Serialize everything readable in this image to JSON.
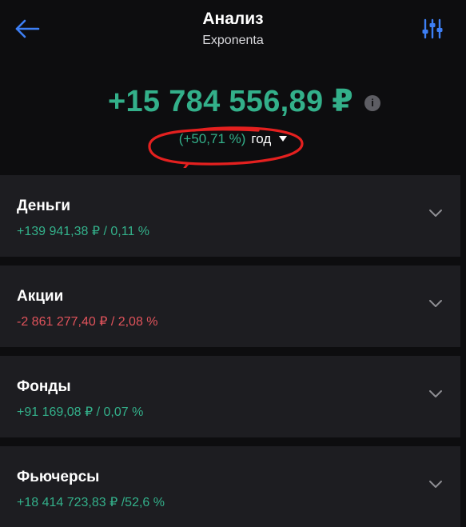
{
  "header": {
    "title": "Анализ",
    "subtitle": "Exponenta",
    "back_icon": "back-arrow-icon",
    "filter_icon": "sliders-icon"
  },
  "summary": {
    "total": "+15 784 556,89 ₽",
    "info_icon": "i",
    "percent": "(+50,71 %)",
    "period": "год"
  },
  "colors": {
    "accent_blue": "#3d7ff5",
    "positive": "#33b08a",
    "negative": "#e0535b",
    "card_bg": "#1d1d21",
    "annotation": "#e4201f"
  },
  "categories": [
    {
      "name": "Деньги",
      "value": "+139 941,38 ₽ / 0,11 %",
      "trend": "positive"
    },
    {
      "name": "Акции",
      "value": "-2 861 277,40 ₽ / 2,08 %",
      "trend": "negative"
    },
    {
      "name": "Фонды",
      "value": "+91 169,08 ₽ / 0,07 %",
      "trend": "positive"
    },
    {
      "name": "Фьючерсы",
      "value": "+18 414 723,83 ₽ /52,6 %",
      "trend": "positive"
    }
  ]
}
